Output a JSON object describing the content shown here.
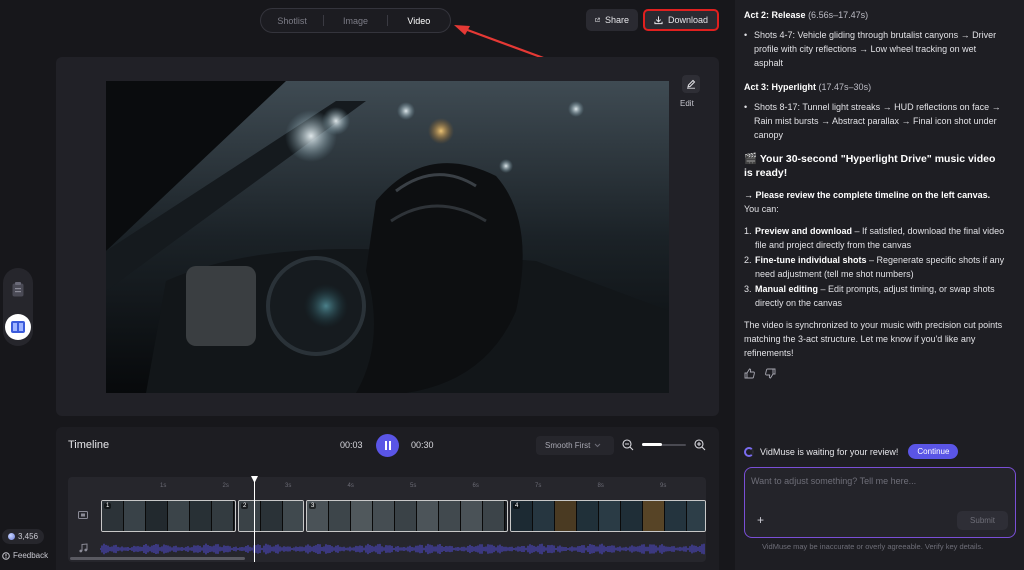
{
  "tabs": {
    "items": [
      "Shotlist",
      "Image",
      "Video"
    ],
    "active": "Video"
  },
  "header": {
    "share_label": "Share",
    "download_label": "Download"
  },
  "preview": {
    "edit_label": "Edit"
  },
  "timeline": {
    "title": "Timeline",
    "current_time": "00:03",
    "total_time": "00:30",
    "transition_mode": "Smooth First",
    "ruler_ticks": [
      "1s",
      "2s",
      "3s",
      "4s",
      "5s",
      "6s",
      "7s",
      "8s",
      "9s"
    ],
    "clips": [
      "1",
      "2",
      "3",
      "4"
    ]
  },
  "sidebar": {
    "credits": "3,456",
    "feedback_label": "Feedback"
  },
  "chat": {
    "act2_title": "Act 2: Release",
    "act2_time": "(6.56s–17.47s)",
    "act2_bullet": "Shots 4-7: Vehicle gliding through brutalist canyons → Driver profile with city reflections → Low wheel tracking on wet asphalt",
    "act3_title": "Act 3: Hyperlight",
    "act3_time": "(17.47s–30s)",
    "act3_bullet": "Shots 8-17: Tunnel light streaks → HUD reflections on face → Rain mist bursts → Abstract parallax → Final icon shot under canopy",
    "ready_emoji": "🎬",
    "ready_text": "Your 30-second \"Hyperlight Drive\" music video is ready!",
    "review_lead": "→ Please review the complete timeline on the left canvas.",
    "review_tail": " You can:",
    "options": [
      {
        "num": "1.",
        "title": "Preview and download",
        "desc": " – If satisfied, download the final video file and project directly from the canvas"
      },
      {
        "num": "2.",
        "title": "Fine-tune individual shots",
        "desc": " – Regenerate specific shots if any need adjustment (tell me shot numbers)"
      },
      {
        "num": "3.",
        "title": "Manual editing",
        "desc": " – Edit prompts, adjust timing, or swap shots directly on the canvas"
      }
    ],
    "closing": "The video is synchronized to your music with precision cut points matching the 3-act structure. Let me know if you'd like any refinements!"
  },
  "status": {
    "waiting_text": "VidMuse is waiting for your review!",
    "continue_label": "Continue"
  },
  "composer": {
    "placeholder": "Want to adjust something? Tell me here...",
    "submit_label": "Submit",
    "disclaimer": "VidMuse may be inaccurate or overly agreeable. Verify key details."
  },
  "colors": {
    "accent": "#5a55e6",
    "highlight_box": "#e0201f",
    "composer_border": "#7a4fd6"
  }
}
